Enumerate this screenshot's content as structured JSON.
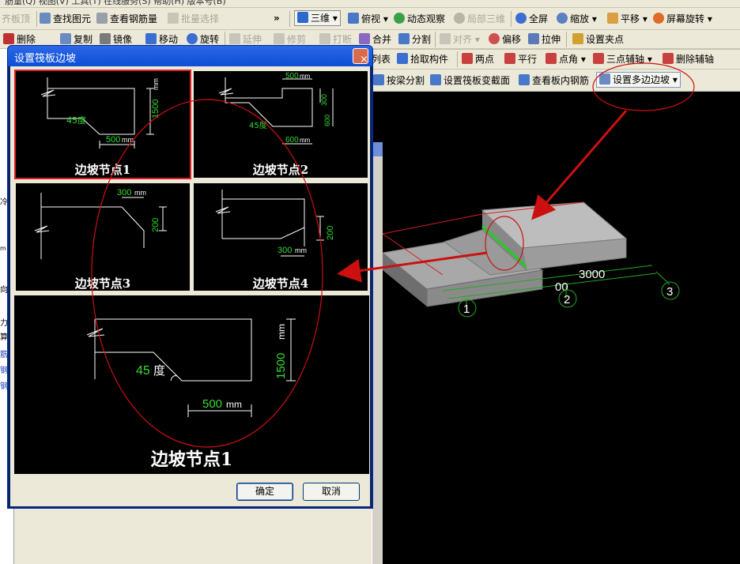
{
  "menubar": {
    "text": "筋量(Q)  视图(V)  工具(T)  在线服务(S)  帮助(H)  版本号(B)"
  },
  "toolbar1": {
    "items": [
      "齐板顶",
      "查找图元",
      "查看钢筋量",
      "批量选择",
      "三维",
      "俯视",
      "动态观察",
      "局部三维",
      "全屏",
      "缩放",
      "平移",
      "屏幕旋转"
    ],
    "overflow": "»"
  },
  "toolbar2": {
    "items": [
      "删除",
      "复制",
      "镜像",
      "移动",
      "旋转",
      "延伸",
      "修剪",
      "打断",
      "合并",
      "分割",
      "对齐",
      "偏移",
      "拉伸",
      "设置夹点"
    ]
  },
  "toolbar3": {
    "items": [
      "列表",
      "拾取构件",
      "两点",
      "平行",
      "点角",
      "三点辅轴",
      "删除辅轴"
    ]
  },
  "toolbar4": {
    "items": [
      "按梁分割",
      "设置筏板变截面",
      "查看板内钢筋",
      "设置多边边坡"
    ]
  },
  "left_panel": {
    "fragments": [
      "冷",
      "m",
      "向",
      "力",
      "算",
      "筋",
      "钢",
      "钢"
    ]
  },
  "dialog": {
    "title": "设置筏板边坡",
    "close": "×",
    "nodes": [
      {
        "label": "边坡节点1",
        "angle": "45度",
        "width": "500",
        "height": "1500",
        "unit": "mm"
      },
      {
        "label": "边坡节点2",
        "angle": "45度",
        "top": "500",
        "h1": "300",
        "h2": "600",
        "bottom": "600",
        "unit": "mm"
      },
      {
        "label": "边坡节点3",
        "top": "300",
        "height": "200",
        "unit": "mm"
      },
      {
        "label": "边坡节点4",
        "bottom": "300",
        "height": "200",
        "unit": "mm"
      }
    ],
    "preview": {
      "label": "边坡节点1",
      "angle_num": "45",
      "angle_unit": "度",
      "width": "500",
      "height": "1500",
      "unit": "mm"
    },
    "ok": "确定",
    "cancel": "取消"
  },
  "viewport": {
    "dim": "3000",
    "dim_partial": "00",
    "axes": [
      "1",
      "2",
      "3"
    ]
  },
  "colors": {
    "selection": "#e02020",
    "title_bar": "#0b4fd6",
    "annotation": "#cc1010",
    "green_text": "#33dd33"
  }
}
